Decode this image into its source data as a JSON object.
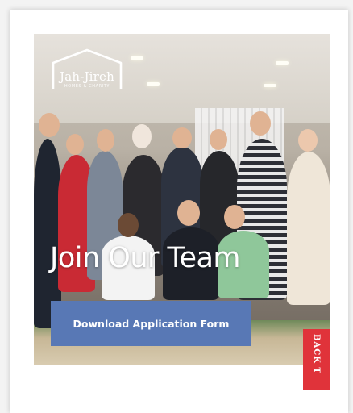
{
  "logo": {
    "name": "Jah-Jireh",
    "subtitle": "HOMES & CHARITY"
  },
  "hero": {
    "headline": "Join Our Team",
    "cta_label": "Download Application Form"
  },
  "back_to_top": {
    "label": "BACK T"
  },
  "colors": {
    "cta": "#5878b5",
    "back_to_top": "#e0333a"
  }
}
